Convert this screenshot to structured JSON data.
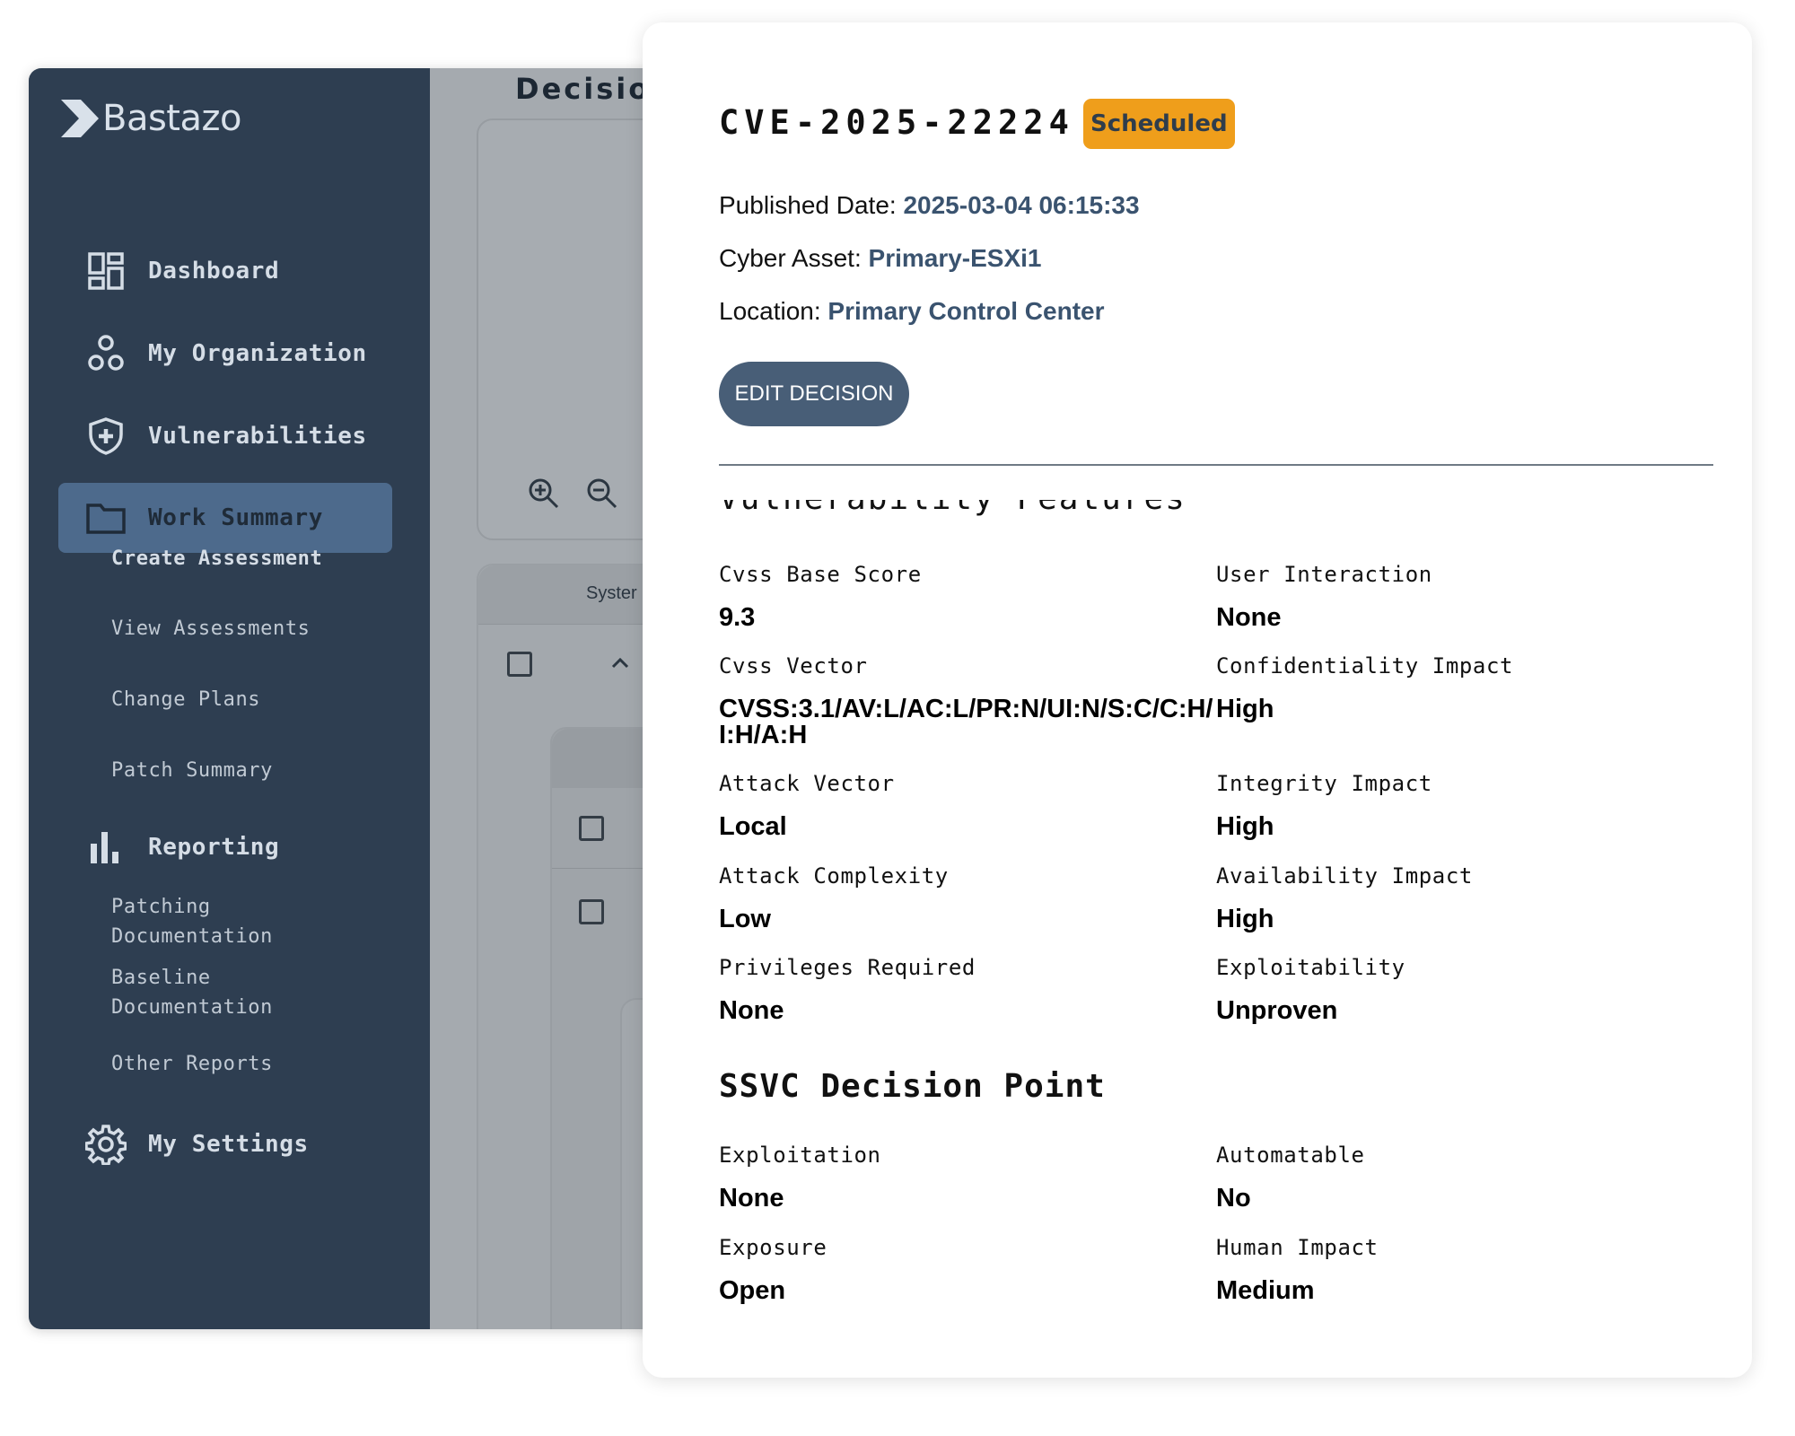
{
  "sidebar": {
    "logo_text": "Bastazo",
    "nav": {
      "dashboard": "Dashboard",
      "organization": "My Organization",
      "vulnerabilities": "Vulnerabilities",
      "work_summary": "Work Summary",
      "reporting": "Reporting",
      "settings": "My Settings"
    },
    "work_summary_items": {
      "create": "Create Assessment",
      "view": "View Assessments",
      "change": "Change Plans",
      "patch": "Patch Summary"
    },
    "reporting_items": {
      "patching_1": "Patching",
      "patching_2": "Documentation",
      "baseline_1": "Baseline",
      "baseline_2": "Documentation",
      "other": "Other Reports"
    }
  },
  "main": {
    "page_title": "Decisio",
    "table_header_partial": "Syster"
  },
  "detail": {
    "cve_id": "CVE-2025-22224",
    "status": "Scheduled",
    "published_label": "Published Date: ",
    "published_value": "2025-03-04 06:15:33",
    "asset_label": "Cyber Asset: ",
    "asset_value": "Primary-ESXi1",
    "location_label": "Location: ",
    "location_value": "Primary Control Center",
    "edit_button": "EDIT DECISION",
    "cut_heading": "Vulnerability Features",
    "features": {
      "cvss_base_score_label": "Cvss Base Score",
      "cvss_base_score": "9.3",
      "user_interaction_label": "User Interaction",
      "user_interaction": "None",
      "cvss_vector_label": "Cvss Vector",
      "cvss_vector_line1": "CVSS:3.1/AV:L/AC:L/PR:N/UI:N/S:C/C:H/",
      "cvss_vector_line2": "I:H/A:H",
      "confidentiality_label": "Confidentiality Impact",
      "confidentiality": "High",
      "attack_vector_label": "Attack Vector",
      "attack_vector": "Local",
      "integrity_label": "Integrity Impact",
      "integrity": "High",
      "attack_complexity_label": "Attack Complexity",
      "attack_complexity": "Low",
      "availability_label": "Availability Impact",
      "availability": "High",
      "privileges_label": "Privileges Required",
      "privileges": "None",
      "exploitability_label": "Exploitability",
      "exploitability": "Unproven"
    },
    "ssvc_heading": "SSVC Decision Point",
    "ssvc": {
      "exploitation_label": "Exploitation",
      "exploitation": "None",
      "automatable_label": "Automatable",
      "automatable": "No",
      "exposure_label": "Exposure",
      "exposure": "Open",
      "human_impact_label": "Human Impact",
      "human_impact": "Medium"
    }
  },
  "colors": {
    "sidebar_bg": "#2e3e51",
    "active_nav_bg": "#4d6a8c",
    "status_badge_bg": "#ef9e1b",
    "edit_button_bg": "#485e77",
    "meta_value_text": "#3a536f"
  },
  "icons": {
    "logo": "chevron-logo-icon",
    "dashboard": "dashboard-grid-icon",
    "organization": "organization-circles-icon",
    "vulnerabilities": "shield-plus-icon",
    "work_summary": "folder-icon",
    "reporting": "bar-chart-icon",
    "settings": "gear-icon",
    "zoom_in": "zoom-in-icon",
    "zoom_out": "zoom-out-icon",
    "collapse": "chevron-up-icon"
  }
}
